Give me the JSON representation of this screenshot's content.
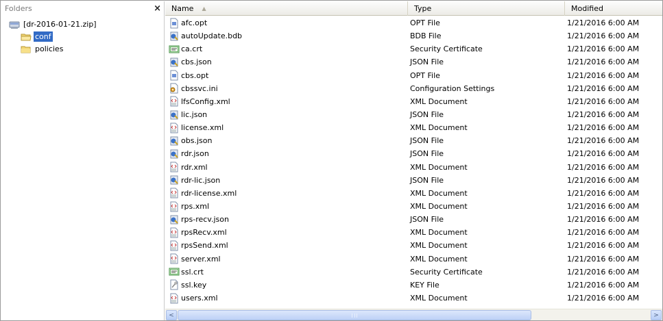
{
  "folders_pane": {
    "title": "Folders",
    "close_label": "×",
    "tree": [
      {
        "label": "[dr-2016-01-21.zip]",
        "icon": "zip-drive-icon",
        "selected": false
      },
      {
        "label": "conf",
        "icon": "folder-open-icon",
        "selected": true
      },
      {
        "label": "policies",
        "icon": "folder-icon",
        "selected": false
      }
    ]
  },
  "file_list": {
    "columns": {
      "name": "Name",
      "type": "Type",
      "modified": "Modified"
    },
    "sort_indicator": "▲",
    "files": [
      {
        "name": "afc.opt",
        "type": "OPT File",
        "modified": "1/21/2016 6:00 AM",
        "icon": "opt-file-icon"
      },
      {
        "name": "autoUpdate.bdb",
        "type": "BDB File",
        "modified": "1/21/2016 6:00 AM",
        "icon": "script-file-icon"
      },
      {
        "name": "ca.crt",
        "type": "Security Certificate",
        "modified": "1/21/2016 6:00 AM",
        "icon": "certificate-icon"
      },
      {
        "name": "cbs.json",
        "type": "JSON File",
        "modified": "1/21/2016 6:00 AM",
        "icon": "script-file-icon"
      },
      {
        "name": "cbs.opt",
        "type": "OPT File",
        "modified": "1/21/2016 6:00 AM",
        "icon": "opt-file-icon"
      },
      {
        "name": "cbssvc.ini",
        "type": "Configuration Settings",
        "modified": "1/21/2016 6:00 AM",
        "icon": "settings-file-icon"
      },
      {
        "name": "lfsConfig.xml",
        "type": "XML Document",
        "modified": "1/21/2016 6:00 AM",
        "icon": "xml-file-icon"
      },
      {
        "name": "lic.json",
        "type": "JSON File",
        "modified": "1/21/2016 6:00 AM",
        "icon": "script-file-icon"
      },
      {
        "name": "license.xml",
        "type": "XML Document",
        "modified": "1/21/2016 6:00 AM",
        "icon": "xml-file-icon"
      },
      {
        "name": "obs.json",
        "type": "JSON File",
        "modified": "1/21/2016 6:00 AM",
        "icon": "script-file-icon"
      },
      {
        "name": "rdr.json",
        "type": "JSON File",
        "modified": "1/21/2016 6:00 AM",
        "icon": "script-file-icon"
      },
      {
        "name": "rdr.xml",
        "type": "XML Document",
        "modified": "1/21/2016 6:00 AM",
        "icon": "xml-file-icon"
      },
      {
        "name": "rdr-lic.json",
        "type": "JSON File",
        "modified": "1/21/2016 6:00 AM",
        "icon": "script-file-icon"
      },
      {
        "name": "rdr-license.xml",
        "type": "XML Document",
        "modified": "1/21/2016 6:00 AM",
        "icon": "xml-file-icon"
      },
      {
        "name": "rps.xml",
        "type": "XML Document",
        "modified": "1/21/2016 6:00 AM",
        "icon": "xml-file-icon"
      },
      {
        "name": "rps-recv.json",
        "type": "JSON File",
        "modified": "1/21/2016 6:00 AM",
        "icon": "script-file-icon"
      },
      {
        "name": "rpsRecv.xml",
        "type": "XML Document",
        "modified": "1/21/2016 6:00 AM",
        "icon": "xml-file-icon"
      },
      {
        "name": "rpsSend.xml",
        "type": "XML Document",
        "modified": "1/21/2016 6:00 AM",
        "icon": "xml-file-icon"
      },
      {
        "name": "server.xml",
        "type": "XML Document",
        "modified": "1/21/2016 6:00 AM",
        "icon": "xml-file-icon"
      },
      {
        "name": "ssl.crt",
        "type": "Security Certificate",
        "modified": "1/21/2016 6:00 AM",
        "icon": "certificate-icon"
      },
      {
        "name": "ssl.key",
        "type": "KEY File",
        "modified": "1/21/2016 6:00 AM",
        "icon": "key-file-icon"
      },
      {
        "name": "users.xml",
        "type": "XML Document",
        "modified": "1/21/2016 6:00 AM",
        "icon": "xml-file-icon"
      }
    ]
  },
  "scrollbar": {
    "left_arrow": "<",
    "right_arrow": ">"
  },
  "colors": {
    "selection": "#316ac5",
    "header_border": "#c5c2b2",
    "scrollbar_thumb": "#bed1f6"
  }
}
